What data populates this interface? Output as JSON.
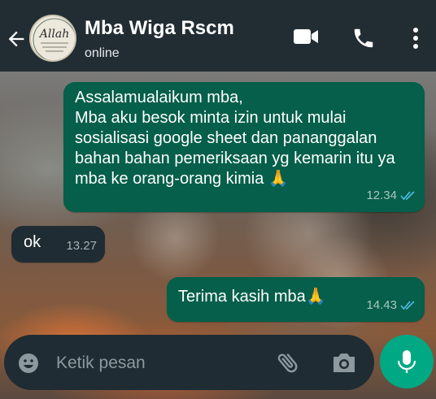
{
  "header": {
    "contact_name": "Mba Wiga Rscm",
    "status": "online",
    "avatar_text": "Allah"
  },
  "messages": [
    {
      "direction": "outgoing",
      "text": "Assalamualaikum mba,\nMba aku besok minta izin untuk mulai sosialisasi  google sheet dan pananggalan bahan bahan pemeriksaan yg kemarin itu ya mba ke orang-orang kimia 🙏",
      "time": "12.34",
      "read": true
    },
    {
      "direction": "incoming",
      "text": "ok",
      "time": "13.27"
    },
    {
      "direction": "outgoing",
      "text": "Terima kasih mba🙏",
      "time": "14.43",
      "read": true
    }
  ],
  "composer": {
    "placeholder": "Ketik pesan"
  },
  "icons": [
    "back-arrow-icon",
    "video-call-icon",
    "phone-icon",
    "more-options-icon",
    "emoji-icon",
    "attach-icon",
    "camera-icon",
    "microphone-icon",
    "double-check-icon"
  ],
  "colors": {
    "header_bg": "#222d33",
    "outgoing_bubble": "#055f4a",
    "incoming_bubble": "#1f2c33",
    "accent": "#00a884",
    "read_tick": "#53bdeb"
  }
}
